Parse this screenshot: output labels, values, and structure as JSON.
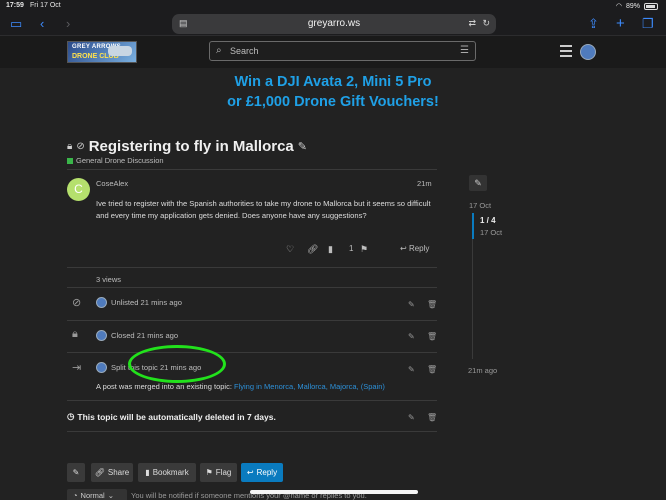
{
  "status": {
    "time": "17:59",
    "date": "Fri 17 Oct",
    "battery": "89%"
  },
  "browser": {
    "url": "greyarro.ws"
  },
  "site": {
    "logo_line1": "GREY ARROWS",
    "logo_line2": "DRONE CLUB",
    "search_placeholder": "Search"
  },
  "banner": {
    "line1": "Win a DJI Avata 2, Mini 5 Pro",
    "line2": "or £1,000 Drone Gift Vouchers!"
  },
  "topic": {
    "title": "Registering to fly in Mallorca",
    "category": "General Drone Discussion",
    "category_color": "#3ab54a"
  },
  "post": {
    "avatar_letter": "C",
    "author": "CoseAlex",
    "time": "21m",
    "body": "Ive tried to register with the Spanish authorities to take my drone to Mallorca but it seems so difficult and every time my application gets denied. Does anyone have any suggestions?",
    "link_count": "1",
    "reply_label": "Reply"
  },
  "views": "3 views",
  "events": [
    {
      "text": "Unlisted 21 mins ago"
    },
    {
      "text": "Closed 21 mins ago"
    },
    {
      "text": "Split this topic 21 mins ago"
    }
  ],
  "merged": {
    "prefix": "A post was merged into an existing topic:",
    "link": "Flying in Menorca, Mallorca, Majorca, (Spain)"
  },
  "autodelete": "This topic will be automatically deleted in 7 days.",
  "timeline": {
    "top_date": "17 Oct",
    "position": "1 / 4",
    "position_date": "17 Oct",
    "bottom": "21m ago"
  },
  "footer_buttons": {
    "share": "Share",
    "bookmark": "Bookmark",
    "flag": "Flag",
    "reply": "Reply"
  },
  "notification": {
    "level": "Normal",
    "text": "You will be notified if someone mentions your @name or replies to you."
  },
  "colors": {
    "accent": "#0a7bbf",
    "banner": "#1fa0e6",
    "highlight": "#22e21c"
  }
}
